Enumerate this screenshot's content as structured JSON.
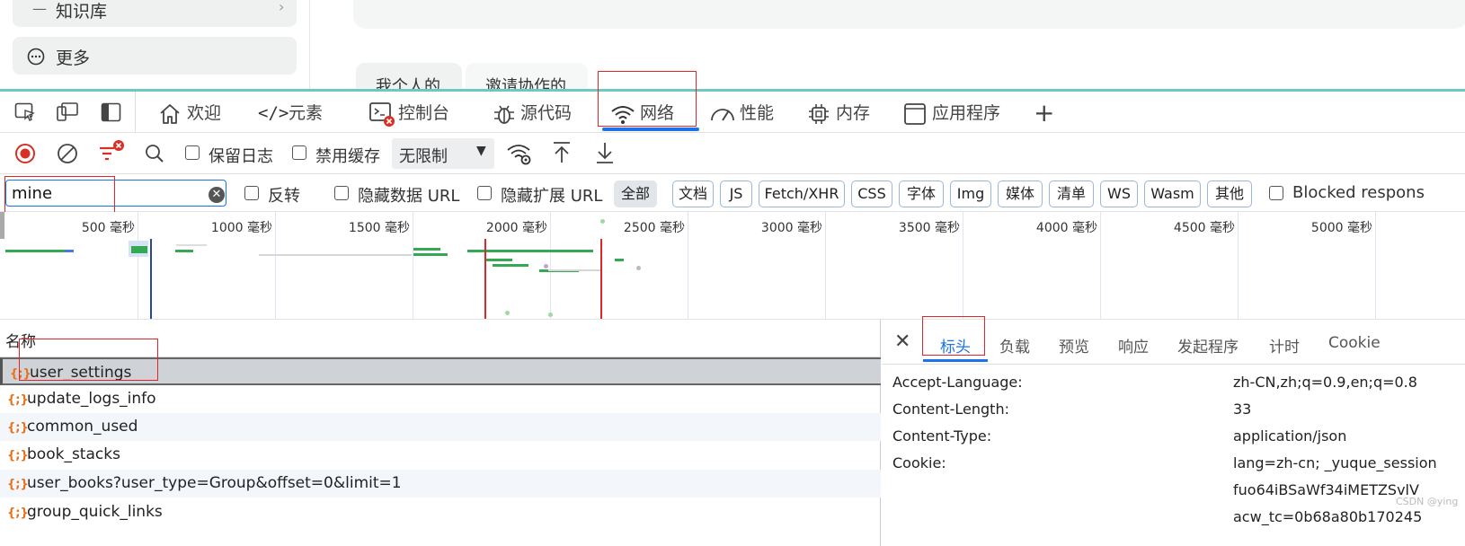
{
  "app": {
    "sidebar_knowledge": "知识库",
    "sidebar_more": "更多",
    "tabs": [
      "我个人的",
      "邀请协作的"
    ]
  },
  "devtools": {
    "tabs": [
      {
        "icon": "home-icon",
        "label": "欢迎"
      },
      {
        "icon": "code-icon",
        "label": "元素"
      },
      {
        "icon": "console-icon",
        "label": "控制台"
      },
      {
        "icon": "bug-icon",
        "label": "源代码"
      },
      {
        "icon": "wifi-icon",
        "label": "网络"
      },
      {
        "icon": "gauge-icon",
        "label": "性能"
      },
      {
        "icon": "chip-icon",
        "label": "内存"
      },
      {
        "icon": "window-icon",
        "label": "应用程序"
      }
    ],
    "active_tab": "网络",
    "toolbar": {
      "preserve_log": "保留日志",
      "disable_cache": "禁用缓存",
      "throttle": "无限制"
    },
    "filter": {
      "value": "mine",
      "invert": "反转",
      "hide_data_urls": "隐藏数据 URL",
      "hide_ext_urls": "隐藏扩展 URL",
      "types": [
        "全部",
        "文档",
        "JS",
        "Fetch/XHR",
        "CSS",
        "字体",
        "Img",
        "媒体",
        "清单",
        "WS",
        "Wasm",
        "其他"
      ],
      "blocked": "Blocked respons"
    },
    "timeline_ticks": [
      "500 毫秒",
      "1000 毫秒",
      "1500 毫秒",
      "2000 毫秒",
      "2500 毫秒",
      "3000 毫秒",
      "3500 毫秒",
      "4000 毫秒",
      "4500 毫秒",
      "5000 毫秒"
    ],
    "list": {
      "header": "名称",
      "rows": [
        "user_settings",
        "update_logs_info",
        "common_used",
        "book_stacks",
        "user_books?user_type=Group&offset=0&limit=1",
        "group_quick_links"
      ]
    },
    "details": {
      "tabs": [
        "标头",
        "负载",
        "预览",
        "响应",
        "发起程序",
        "计时",
        "Cookie"
      ],
      "headers": [
        {
          "key": "Accept-Language:",
          "value": "zh-CN,zh;q=0.9,en;q=0.8"
        },
        {
          "key": "Content-Length:",
          "value": "33"
        },
        {
          "key": "Content-Type:",
          "value": "application/json"
        },
        {
          "key": "Cookie:",
          "value": "lang=zh-cn; _yuque_session"
        }
      ],
      "cookie_cont": [
        "fuo64iBSaWf34iMETZSvlV",
        "acw_tc=0b68a80b170245"
      ]
    },
    "watermark": "CSDN @ying"
  }
}
